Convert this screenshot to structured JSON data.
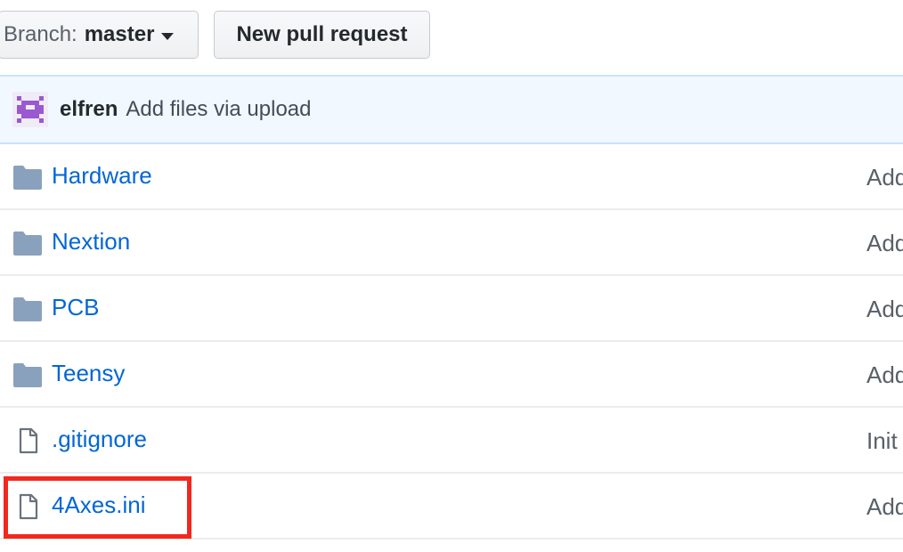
{
  "toolbar": {
    "branch_prefix": "Branch:",
    "branch_name": "master",
    "new_pr_label": "New pull request"
  },
  "commit": {
    "author": "elfren",
    "message": "Add files via upload"
  },
  "files": [
    {
      "name": "Hardware",
      "type": "folder",
      "message": "Add"
    },
    {
      "name": "Nextion",
      "type": "folder",
      "message": "Add"
    },
    {
      "name": "PCB",
      "type": "folder",
      "message": "Add"
    },
    {
      "name": "Teensy",
      "type": "folder",
      "message": "Add"
    },
    {
      "name": ".gitignore",
      "type": "file",
      "message": "Init"
    },
    {
      "name": "4Axes.ini",
      "type": "file",
      "message": "Add"
    }
  ],
  "colors": {
    "link": "#0366d6",
    "folder_icon": "#79b8ff",
    "highlight": "#f2281e",
    "avatar": "#9b59d0"
  }
}
